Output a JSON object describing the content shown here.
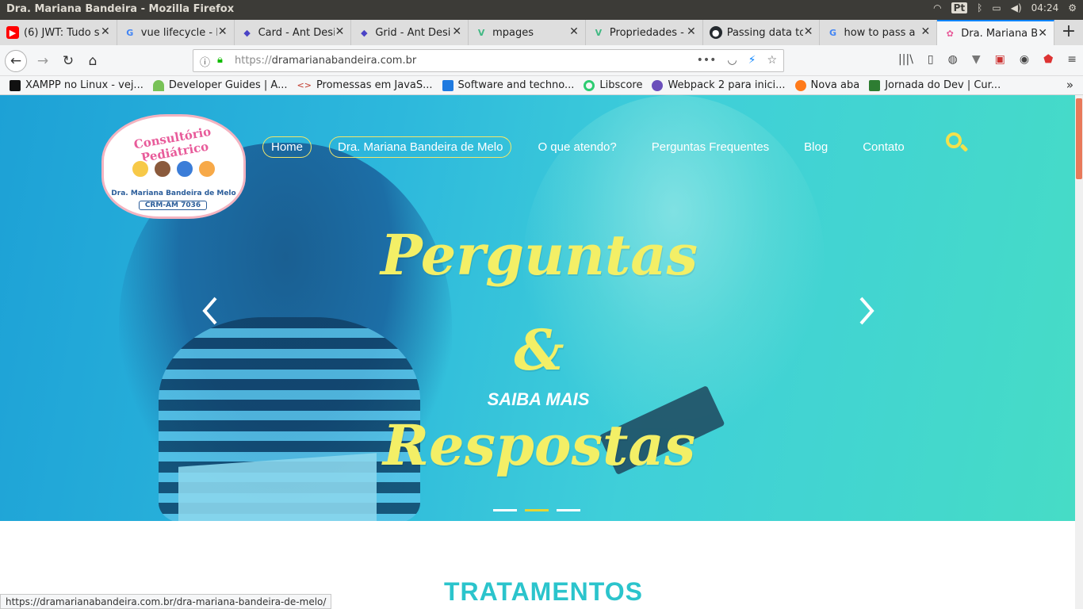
{
  "os": {
    "window_title": "Dra. Mariana Bandeira - Mozilla Firefox",
    "input_method": "Pt",
    "clock": "04:24"
  },
  "tabs": [
    {
      "label": "(6) JWT: Tudo s",
      "icon": "youtube-icon",
      "color": "#ff0000"
    },
    {
      "label": "vue lifecycle - F",
      "icon": "google-icon",
      "color": "#4285f4"
    },
    {
      "label": "Card - Ant Desi",
      "icon": "antd-icon",
      "color": "#4a43c6"
    },
    {
      "label": "Grid - Ant Desi",
      "icon": "antd-icon",
      "color": "#4a43c6"
    },
    {
      "label": "mpages",
      "icon": "vue-icon",
      "color": "#41b883"
    },
    {
      "label": "Propriedades -",
      "icon": "vue-icon",
      "color": "#41b883"
    },
    {
      "label": "Passing data to",
      "icon": "github-icon",
      "color": "#24292e"
    },
    {
      "label": "how to pass a",
      "icon": "google-icon",
      "color": "#4285f4"
    },
    {
      "label": "Dra. Mariana B",
      "icon": "site-icon",
      "color": "#e85b9a",
      "active": true
    }
  ],
  "navbar": {
    "url_protocol": "https://",
    "url_host": "dramarianabandeira.com.br"
  },
  "bookmarks": [
    {
      "label": "XAMPP no Linux - vej...",
      "color": "#111111"
    },
    {
      "label": "Developer Guides | A...",
      "color": "#78c257"
    },
    {
      "label": "Promessas em JavaS...",
      "color": "#c0392b"
    },
    {
      "label": "Software and techno...",
      "color": "#1f7ae0"
    },
    {
      "label": "Libscore",
      "color": "#2ecc71"
    },
    {
      "label": "Webpack 2 para inici...",
      "color": "#6b4fbb"
    },
    {
      "label": "Nova aba",
      "color": "#ff7a1a"
    },
    {
      "label": "Jornada do Dev | Cur...",
      "color": "#2e7d32"
    }
  ],
  "site": {
    "logo": {
      "title": "Consultório Pediátrico",
      "name": "Dra. Mariana Bandeira de Melo",
      "crm": "CRM-AM 7036"
    },
    "menu": [
      {
        "label": "Home",
        "highlight": true
      },
      {
        "label": "Dra. Mariana Bandeira de Melo",
        "highlight": true
      },
      {
        "label": "O que atendo?",
        "highlight": false
      },
      {
        "label": "Perguntas Frequentes",
        "highlight": false
      },
      {
        "label": "Blog",
        "highlight": false
      },
      {
        "label": "Contato",
        "highlight": false
      }
    ],
    "hero": {
      "headline_line1": "Perguntas &",
      "headline_line2": "Respostas",
      "cta": "SAIBA MAIS",
      "slides_total": 3,
      "slide_active": 2
    },
    "section_title": "TRATAMENTOS"
  },
  "status_bar": "https://dramarianabandeira.com.br/dra-mariana-bandeira-de-melo/",
  "colors": {
    "accent_yellow": "#f3ef66",
    "section_teal": "#2bc4cc",
    "menu_highlight": "#f3e76a"
  }
}
